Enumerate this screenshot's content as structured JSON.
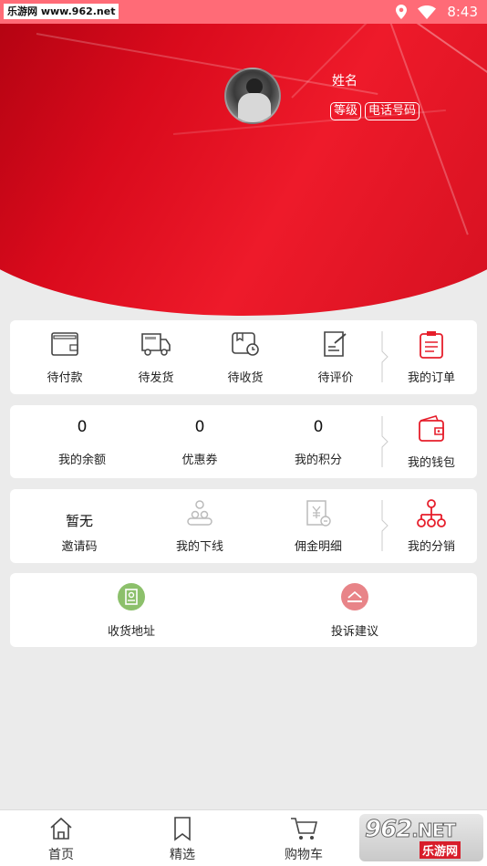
{
  "status_bar": {
    "watermark": "乐游网 www.962.net",
    "time": "8:43",
    "icons": [
      "location-icon",
      "wifi-icon"
    ]
  },
  "profile": {
    "name": "姓名",
    "level_label": "等级",
    "phone_label": "电话号码"
  },
  "orders": {
    "items": [
      {
        "label": "待付款",
        "icon": "wallet-icon"
      },
      {
        "label": "待发货",
        "icon": "truck-icon"
      },
      {
        "label": "待收货",
        "icon": "receive-icon"
      },
      {
        "label": "待评价",
        "icon": "review-icon"
      }
    ],
    "main": {
      "label": "我的订单",
      "icon": "clipboard-icon"
    }
  },
  "wallet": {
    "items": [
      {
        "value": "0",
        "label": "我的余额"
      },
      {
        "value": "0",
        "label": "优惠券"
      },
      {
        "value": "0",
        "label": "我的积分"
      }
    ],
    "main": {
      "label": "我的钱包",
      "icon": "wallet-icon"
    }
  },
  "distribution": {
    "invite_value": "暂无",
    "invite_label": "邀请码",
    "downline_label": "我的下线",
    "commission_label": "佣金明细",
    "main_label": "我的分销"
  },
  "services": {
    "address_label": "收货地址",
    "feedback_label": "投诉建议"
  },
  "tabbar": {
    "tabs": [
      {
        "label": "首页",
        "icon": "home-icon"
      },
      {
        "label": "精选",
        "icon": "bookmark-icon"
      },
      {
        "label": "购物车",
        "icon": "cart-icon"
      }
    ]
  },
  "logo": {
    "number": "962",
    "suffix": ".NET",
    "text": "乐游网"
  },
  "colors": {
    "accent": "#e61e2b",
    "status_bar": "#ff6b77",
    "address_icon_bg": "#8cc06b",
    "feedback_icon_bg": "#e88488"
  }
}
